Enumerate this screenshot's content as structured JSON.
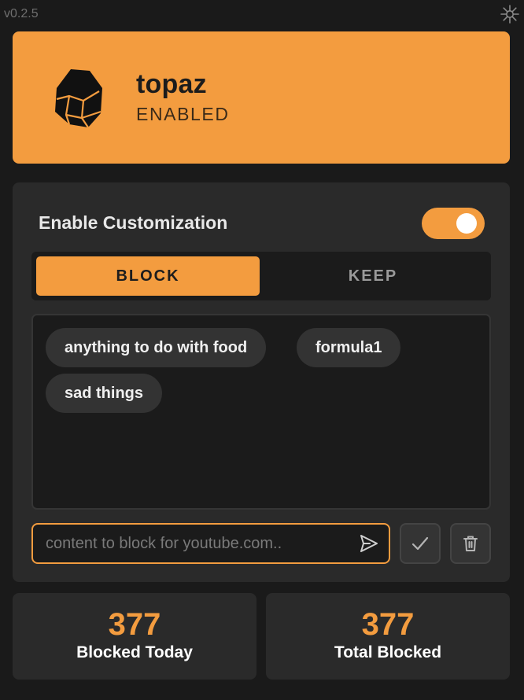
{
  "app": {
    "version": "v0.2.5",
    "name": "topaz",
    "status": "ENABLED"
  },
  "customization": {
    "label": "Enable Customization",
    "enabled": true,
    "tabs": [
      {
        "label": "BLOCK",
        "active": true
      },
      {
        "label": "KEEP",
        "active": false
      }
    ],
    "topics": [
      "anything to do with food",
      "formula1",
      "sad things"
    ],
    "input": {
      "value": "",
      "placeholder": "content to block for youtube.com.."
    }
  },
  "stats": [
    {
      "value": "377",
      "label": "Blocked Today"
    },
    {
      "value": "377",
      "label": "Total Blocked"
    }
  ],
  "icons": {
    "settings": "gear-icon",
    "logo": "topaz-logo-icon",
    "send": "send-icon",
    "confirm": "checkmark-icon",
    "delete": "trash-icon"
  },
  "colors": {
    "accent": "#f39c3f",
    "background": "#1a1a1a",
    "panel": "#2a2a2a"
  }
}
